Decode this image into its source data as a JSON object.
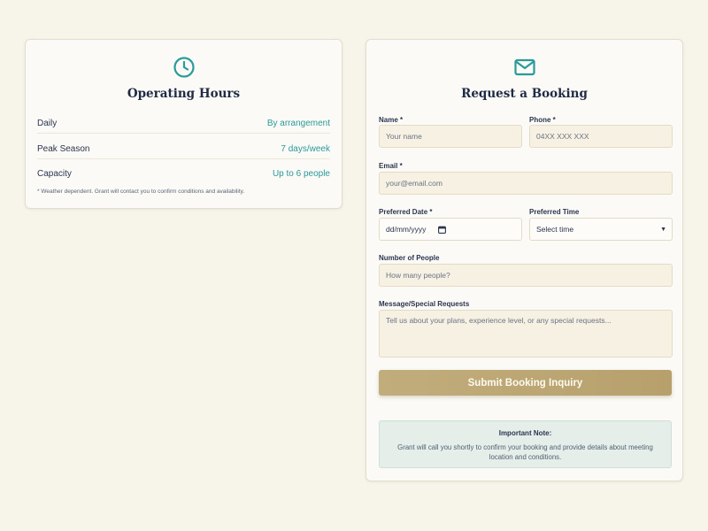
{
  "colors": {
    "accent": "#2a9a9a",
    "button": "#bca674",
    "background": "#f7f4ea"
  },
  "hours": {
    "icon": "clock-icon",
    "title": "Operating Hours",
    "rows": [
      {
        "label": "Daily",
        "value": "By arrangement"
      },
      {
        "label": "Peak Season",
        "value": "7 days/week"
      },
      {
        "label": "Capacity",
        "value": "Up to 6 people"
      }
    ],
    "note": "* Weather dependent. Grant will contact you to confirm conditions and availability."
  },
  "booking": {
    "icon": "mail-icon",
    "title": "Request a Booking",
    "name": {
      "label": "Name *",
      "placeholder": "Your name"
    },
    "phone": {
      "label": "Phone *",
      "placeholder": "04XX XXX XXX"
    },
    "email": {
      "label": "Email *",
      "placeholder": "your@email.com"
    },
    "date": {
      "label": "Preferred Date *",
      "value": "dd/mm/yyyy"
    },
    "time": {
      "label": "Preferred Time",
      "value": "Select time"
    },
    "people": {
      "label": "Number of People",
      "placeholder": "How many people?"
    },
    "message": {
      "label": "Message/Special Requests",
      "placeholder": "Tell us about your plans, experience level, or any special requests..."
    },
    "submit_label": "Submit Booking Inquiry",
    "note_title": "Important Note:",
    "note_text": "Grant will call you shortly to confirm your booking and provide details about meeting location and conditions."
  }
}
